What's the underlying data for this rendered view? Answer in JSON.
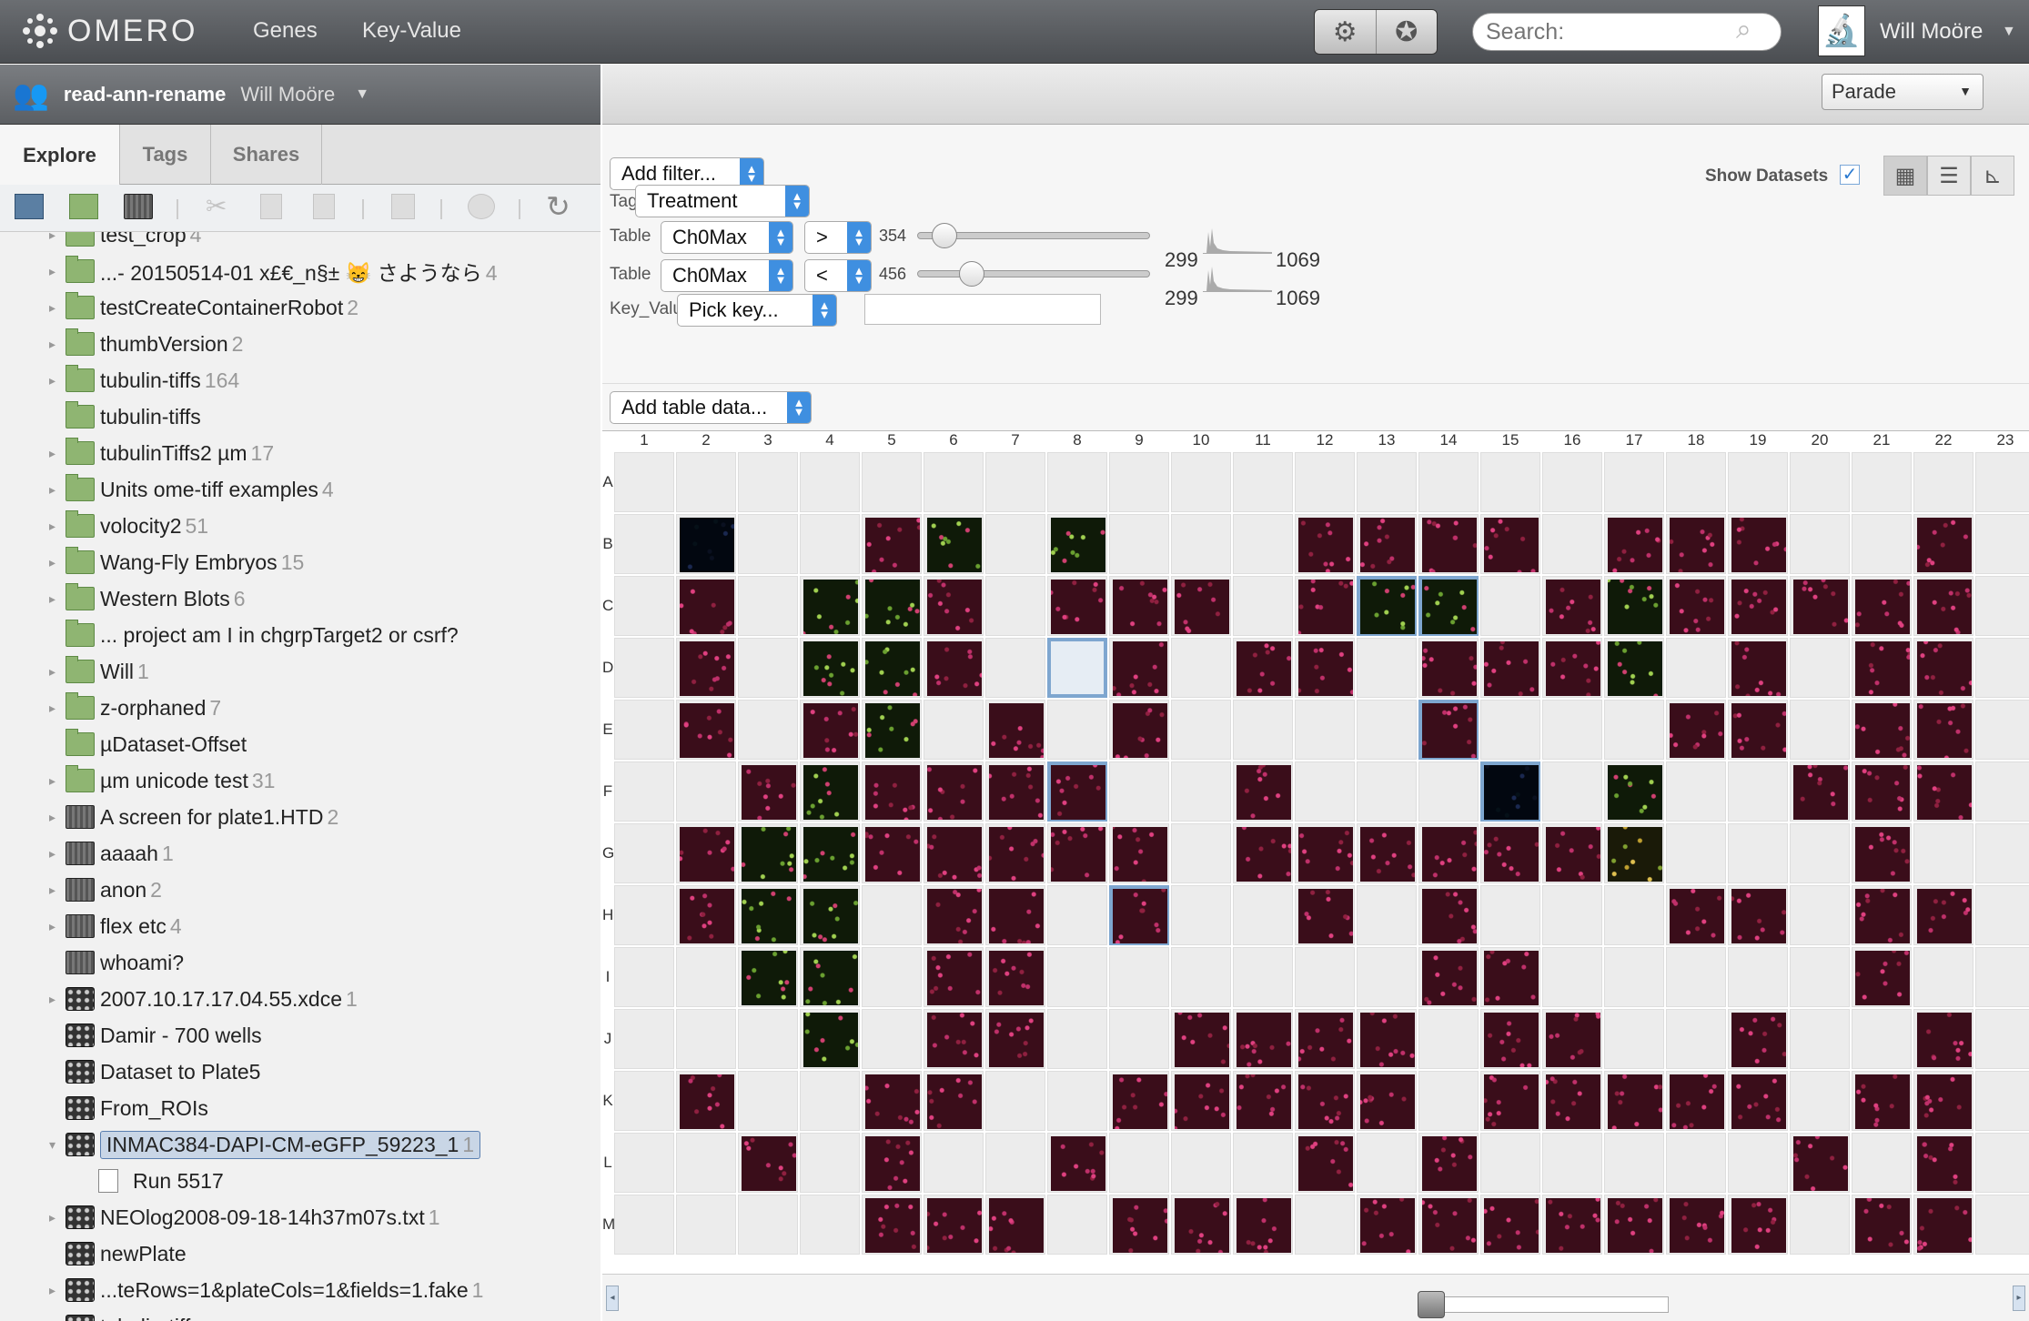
{
  "app": {
    "brand": "OMERO",
    "nav": [
      "Genes",
      "Key-Value"
    ],
    "search_placeholder": "Search:",
    "user": "Will Moöre"
  },
  "group": {
    "name": "read-ann-rename",
    "user": "Will Moöre"
  },
  "tabs": [
    "Explore",
    "Tags",
    "Shares"
  ],
  "tree": [
    {
      "label": "test_crop",
      "count": "4",
      "icon": "folder",
      "arrow": true,
      "clipped": true
    },
    {
      "label": "...- 20150514-01 x£€_n§± 😸  さようなら",
      "count": "4",
      "icon": "folder",
      "arrow": true
    },
    {
      "label": "testCreateContainerRobot",
      "count": "2",
      "icon": "folder",
      "arrow": true
    },
    {
      "label": "thumbVersion",
      "count": "2",
      "icon": "folder",
      "arrow": true
    },
    {
      "label": "tubulin-tiffs",
      "count": "164",
      "icon": "folder",
      "arrow": true
    },
    {
      "label": "tubulin-tiffs",
      "count": "",
      "icon": "folder",
      "arrow": false
    },
    {
      "label": "tubulinTiffs2 µm",
      "count": "17",
      "icon": "folder",
      "arrow": true
    },
    {
      "label": "Units ome-tiff examples",
      "count": "4",
      "icon": "folder",
      "arrow": true
    },
    {
      "label": "volocity2",
      "count": "51",
      "icon": "folder",
      "arrow": true
    },
    {
      "label": "Wang-Fly Embryos",
      "count": "15",
      "icon": "folder",
      "arrow": true
    },
    {
      "label": "Western Blots",
      "count": "6",
      "icon": "folder",
      "arrow": true
    },
    {
      "label": "... project am I in chgrpTarget2 or csrf?",
      "count": "",
      "icon": "folder",
      "arrow": false
    },
    {
      "label": "Will",
      "count": "1",
      "icon": "folder",
      "arrow": true
    },
    {
      "label": "z-orphaned",
      "count": "7",
      "icon": "folder",
      "arrow": true
    },
    {
      "label": "µDataset-Offset",
      "count": "",
      "icon": "folder",
      "arrow": false
    },
    {
      "label": "µm unicode test",
      "count": "31",
      "icon": "folder",
      "arrow": true
    },
    {
      "label": "A screen for plate1.HTD",
      "count": "2",
      "icon": "screen",
      "arrow": true
    },
    {
      "label": "aaaah",
      "count": "1",
      "icon": "screen",
      "arrow": true
    },
    {
      "label": "anon",
      "count": "2",
      "icon": "screen",
      "arrow": true
    },
    {
      "label": "flex etc",
      "count": "4",
      "icon": "screen",
      "arrow": true
    },
    {
      "label": "whoami?",
      "count": "",
      "icon": "screen",
      "arrow": false
    },
    {
      "label": "2007.10.17.17.04.55.xdce",
      "count": "1",
      "icon": "plate",
      "arrow": true
    },
    {
      "label": "Damir - 700 wells",
      "count": "",
      "icon": "plate",
      "arrow": false
    },
    {
      "label": "Dataset to Plate5",
      "count": "",
      "icon": "plate",
      "arrow": false
    },
    {
      "label": "From_ROIs",
      "count": "",
      "icon": "plate",
      "arrow": false
    },
    {
      "label": "INMAC384-DAPI-CM-eGFP_59223_1",
      "count": "1",
      "icon": "plate",
      "arrow": true,
      "selected": true,
      "expanded": true
    },
    {
      "label": "Run 5517",
      "count": "",
      "icon": "file",
      "arrow": false,
      "indent": true
    },
    {
      "label": "NEOlog2008-09-18-14h37m07s.txt",
      "count": "1",
      "icon": "plate",
      "arrow": true
    },
    {
      "label": "newPlate",
      "count": "",
      "icon": "plate",
      "arrow": false
    },
    {
      "label": "...teRows=1&plateCols=1&fields=1.fake",
      "count": "1",
      "icon": "plate",
      "arrow": true
    },
    {
      "label": "tubulin-tiffs",
      "count": "",
      "icon": "plate",
      "arrow": false,
      "clipped": true
    }
  ],
  "layout": {
    "selected": "Parade"
  },
  "filters": {
    "add_filter": "Add filter...",
    "show_datasets": "Show Datasets",
    "tag": {
      "label": "Tag",
      "value": "Treatment"
    },
    "table1": {
      "label": "Table",
      "column": "Ch0Max",
      "op": ">",
      "value": "354",
      "min": "299",
      "max": "1069",
      "fraction": 0.07
    },
    "table2": {
      "label": "Table",
      "column": "Ch0Max",
      "op": "<",
      "value": "456",
      "min": "299",
      "max": "1069",
      "fraction": 0.2
    },
    "kv": {
      "label": "Key_Value",
      "key": "Pick key..."
    },
    "add_table_data": "Add table data..."
  },
  "plate": {
    "columns": [
      "1",
      "2",
      "3",
      "4",
      "5",
      "6",
      "7",
      "8",
      "9",
      "10",
      "11",
      "12",
      "13",
      "14",
      "15",
      "16",
      "17",
      "18",
      "19",
      "20",
      "21",
      "22",
      "23"
    ],
    "rows": [
      "A",
      "B",
      "C",
      "D",
      "E",
      "F",
      "G",
      "H",
      "I",
      "J",
      "K",
      "L",
      "M"
    ],
    "wells": [
      "........................",
      ".b..rg.g...rrrr.rrr..r.",
      ".r.ggr.rrr.rgg.rgzrrrr.",
      ".r.ggr..r.rr.rrrg.r.rr.",
      ".r.rg.r.r....r...rr.rr.",
      "..rgrrrr..r...b.g..rrr.",
      ".rggrrrrr.rrrrrry...r..",
      ".rgg.rr.r..r.r...rr.rr.",
      "..gg.rr......rr.....r..",
      "...g.rr..rrrr.rr..r..r.",
      ".r..rr..rrrrr.rrrrr.rr.",
      "..r.r..r...r.r.....r.r.",
      "....rrr.rrr.rrrrrrr.rr."
    ],
    "selected": [
      [
        2,
        12
      ],
      [
        2,
        13
      ],
      [
        3,
        7
      ],
      [
        4,
        13
      ],
      [
        5,
        7
      ],
      [
        5,
        14
      ],
      [
        7,
        8
      ]
    ]
  }
}
